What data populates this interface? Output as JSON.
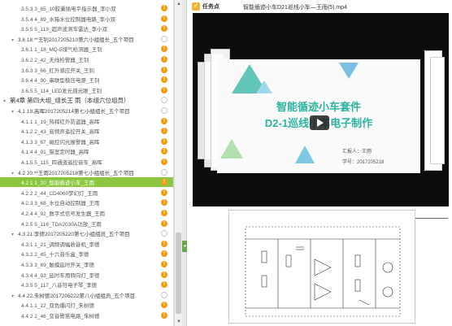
{
  "sidebar": {
    "rows": [
      {
        "text": "3.5.3 3_65_10胶囊插电平指示器_李小双",
        "kind": "item",
        "status": "orange",
        "indent": 26
      },
      {
        "text": "3.5.4 4_89_水箱水位控制器电路_李小双",
        "kind": "item",
        "status": "orange",
        "indent": 26
      },
      {
        "text": "3.5.5 5_113_超声波测车雷达_李小双",
        "kind": "item",
        "status": "orange",
        "indent": 26
      },
      {
        "text": "3.6 18.**王钊2017205210第六小组组长_五个项目",
        "kind": "section",
        "status": "empty",
        "indent": 14
      },
      {
        "text": "3.6.1 1_18_MQ-5煤气检测器_王钊",
        "kind": "item",
        "status": "orange",
        "indent": 26
      },
      {
        "text": "3.6.2 2_42_无线检警器_王钊",
        "kind": "item",
        "status": "orange",
        "indent": 26
      },
      {
        "text": "3.6.3 3_66_红外感应开关_王钊",
        "kind": "item",
        "status": "orange",
        "indent": 26
      },
      {
        "text": "3.6.4 4_90_串联型稳压电源_王钊",
        "kind": "item",
        "status": "orange",
        "indent": 26
      },
      {
        "text": "3.6.5 5_114_LED发光摇光眼_王钊",
        "kind": "item",
        "status": "orange",
        "indent": 26
      },
      {
        "text": "第4章 第四大组_组长王 雨（本组六位组员）",
        "kind": "chapter",
        "status": "empty",
        "indent": 4
      },
      {
        "text": "4.1 19.高晖2017205214第七小组组长_五个项目",
        "kind": "section",
        "status": "empty",
        "indent": 14
      },
      {
        "text": "4.1.1 1_19_热释红外防盗器_高晖",
        "kind": "item",
        "status": "orange",
        "indent": 26
      },
      {
        "text": "4.1.2 2_43_音频声遥控开关_高晖",
        "kind": "item",
        "status": "orange",
        "indent": 26
      },
      {
        "text": "4.1.3 3_67_磁控闪光报警器_高晖",
        "kind": "item",
        "status": "orange",
        "indent": 26
      },
      {
        "text": "4.1.4 4_91_猫室定时器_高晖",
        "kind": "item",
        "status": "orange",
        "indent": 26
      },
      {
        "text": "4.1.5 5_115_四通道遥控音车_高晖",
        "kind": "item",
        "status": "orange",
        "indent": 26
      },
      {
        "text": "4.2 20.**王雨2017205218第七小组组长_五个项目",
        "kind": "section",
        "status": "empty",
        "indent": 14
      },
      {
        "text": "4.2.1 1_20_智能循迹小车_王雨",
        "kind": "item",
        "status": "orange",
        "indent": 26,
        "active": true
      },
      {
        "text": "4.2.2 2_44_CD4060梦幻灯_王雨",
        "kind": "item",
        "status": "orange",
        "indent": 26
      },
      {
        "text": "4.2.3 3_68_水位自动控制器_王雨",
        "kind": "item",
        "status": "orange",
        "indent": 26
      },
      {
        "text": "4.2.4 4_92_数字式信号发生器_王雨",
        "kind": "item",
        "status": "orange",
        "indent": 26
      },
      {
        "text": "4.2.5 5_116_TDA2030A功放_王雨",
        "kind": "item",
        "status": "orange",
        "indent": 26
      },
      {
        "text": "4.3 21.李德2017205220第七小组组员_五个项目",
        "kind": "section",
        "status": "empty",
        "indent": 14
      },
      {
        "text": "4.3.1 1_21_调频调幅收音机_李德",
        "kind": "item",
        "status": "orange",
        "indent": 26
      },
      {
        "text": "4.3.2 2_45_十六音乐盒_李德",
        "kind": "item",
        "status": "orange",
        "indent": 26
      },
      {
        "text": "4.3.3 3_69_触摸延时开关_李德",
        "kind": "item",
        "status": "orange",
        "indent": 26
      },
      {
        "text": "4.3.4 4_93_延时车用转向灯_李德",
        "kind": "item",
        "status": "orange",
        "indent": 26
      },
      {
        "text": "4.3.5 5_117_八音符电子琴_李德",
        "kind": "item",
        "status": "orange",
        "indent": 26
      },
      {
        "text": "4.4 22.朱树德2017205222第八小组组员_五个项目",
        "kind": "section",
        "status": "empty",
        "indent": 14
      },
      {
        "text": "4.4.1 1_22_双色爆闪灯_朱树德",
        "kind": "item",
        "status": "orange",
        "indent": 26
      },
      {
        "text": "4.4.2 2_46_变音警笛电路_朱树德",
        "kind": "item",
        "status": "orange",
        "indent": 26
      }
    ],
    "badge": "!"
  },
  "toolbar": {
    "task_label": "任务点",
    "video_title": "智能循迹小车D21巡线小车—王雨(5).mp4"
  },
  "slide": {
    "title_line1": "智能循迹小车套件",
    "title_line2": "D2-1巡线小车电子制作",
    "author": "汇报人：王雨",
    "student_id": "学号：2017205218"
  },
  "colors": {
    "accent_green": "#8dc63f",
    "status_orange": "#f39c12",
    "slide_teal": "#2db3a0"
  }
}
